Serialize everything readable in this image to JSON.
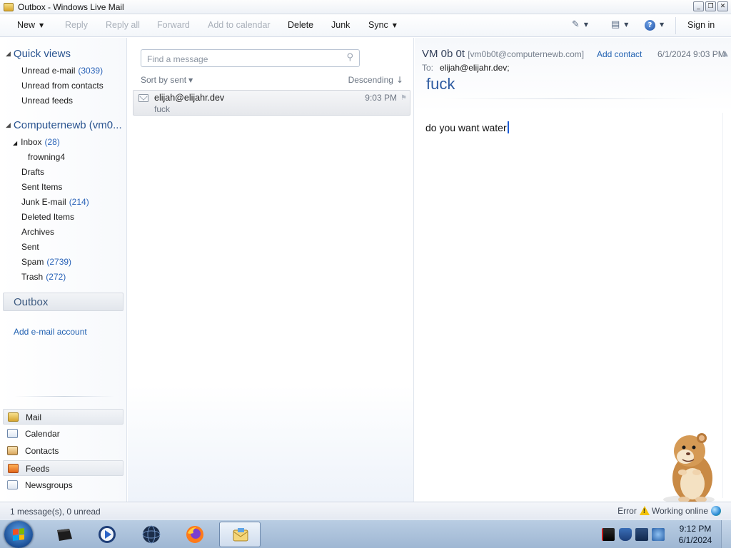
{
  "window": {
    "title": "Outbox - Windows Live Mail",
    "buttons": [
      "minimize",
      "restore",
      "close"
    ]
  },
  "toolbar": {
    "new": "New",
    "reply": "Reply",
    "reply_all": "Reply all",
    "forward": "Forward",
    "add_to_calendar": "Add to calendar",
    "delete": "Delete",
    "junk": "Junk",
    "sync": "Sync",
    "sign_in": "Sign in",
    "icons": [
      "paint-brush-icon",
      "menu-icon",
      "help-icon"
    ]
  },
  "sidebar": {
    "quick_views": {
      "title": "Quick views",
      "items": [
        {
          "label": "Unread e-mail",
          "count": "(3039)"
        },
        {
          "label": "Unread from contacts",
          "count": ""
        },
        {
          "label": "Unread feeds",
          "count": ""
        }
      ]
    },
    "account": {
      "title": "Computernewb (vm0...",
      "inbox": {
        "label": "Inbox",
        "count": "(28)"
      },
      "subfolder": "frowning4",
      "folders": [
        {
          "label": "Drafts",
          "count": ""
        },
        {
          "label": "Sent Items",
          "count": ""
        },
        {
          "label": "Junk E-mail",
          "count": "(214)"
        },
        {
          "label": "Deleted Items",
          "count": ""
        },
        {
          "label": "Archives",
          "count": ""
        },
        {
          "label": "Sent",
          "count": ""
        },
        {
          "label": "Spam",
          "count": "(2739)"
        },
        {
          "label": "Trash",
          "count": "(272)"
        }
      ]
    },
    "outbox": "Outbox",
    "add_account": "Add e-mail account",
    "bottom_nav": [
      "Mail",
      "Calendar",
      "Contacts",
      "Feeds",
      "Newsgroups"
    ]
  },
  "message_list": {
    "search_placeholder": "Find a message",
    "sort_by": "Sort by sent",
    "order": "Descending",
    "messages": [
      {
        "from": "elijah@elijahr.dev",
        "subject": "fuck",
        "time": "9:03 PM"
      }
    ]
  },
  "reading_pane": {
    "from_name": "VM 0b 0t",
    "from_address": "[vm0b0t@computernewb.com]",
    "add_contact": "Add contact",
    "date": "6/1/2024 9:03 PM",
    "to_label": "To:",
    "to": "elijah@elijahr.dev;",
    "subject": "fuck",
    "body": "do you want water"
  },
  "statusbar": {
    "left": "1 message(s), 0 unread",
    "error": "Error",
    "online": "Working online"
  },
  "taskbar": {
    "apps": [
      "terminal",
      "media-player",
      "browser-globe",
      "firefox",
      "windows-live-mail"
    ],
    "time": "9:12 PM",
    "date": "6/1/2024"
  },
  "colors": {
    "accent": "#2a5490",
    "link": "#2463b2",
    "subject": "#2d5aa0"
  }
}
